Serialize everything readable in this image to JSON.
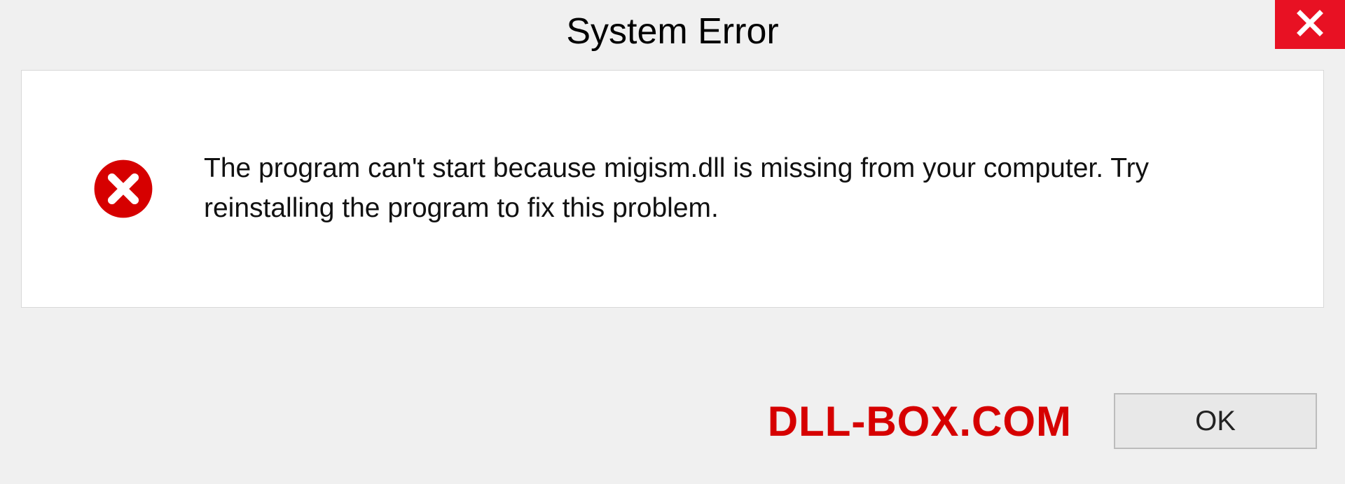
{
  "dialog": {
    "title": "System Error",
    "message": "The program can't start because migism.dll is missing from your computer. Try reinstalling the program to fix this problem.",
    "ok_label": "OK"
  },
  "watermark": "DLL-BOX.COM",
  "colors": {
    "close_bg": "#e81123",
    "error_icon": "#d60000",
    "watermark": "#d60000"
  }
}
